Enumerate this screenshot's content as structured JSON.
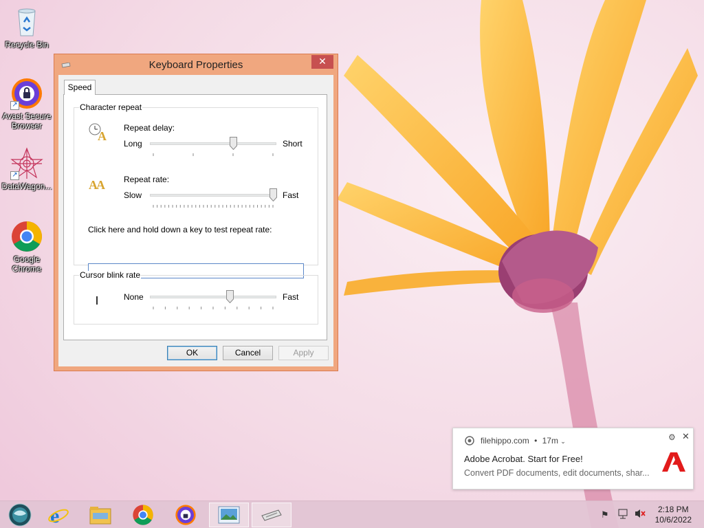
{
  "desktop": {
    "icons": [
      {
        "label": "Recycle Bin"
      },
      {
        "label": "Avast Secure\nBrowser"
      },
      {
        "label": "DataWagon..."
      },
      {
        "label": "Google\nChrome"
      }
    ]
  },
  "dialog": {
    "title": "Keyboard Properties",
    "close_glyph": "✕",
    "tabs": [
      {
        "label": "Speed"
      }
    ],
    "character_repeat": {
      "group_label": "Character repeat",
      "repeat_delay": {
        "label": "Repeat delay:",
        "min_label": "Long",
        "max_label": "Short",
        "value": 0.67,
        "ticks": 4
      },
      "repeat_rate": {
        "label": "Repeat rate:",
        "min_label": "Slow",
        "max_label": "Fast",
        "value": 1.0,
        "ticks": 32
      },
      "test_label": "Click here and hold down a key to test repeat rate:",
      "test_value": ""
    },
    "cursor_blink": {
      "group_label": "Cursor blink rate",
      "min_label": "None",
      "max_label": "Fast",
      "value": 0.64,
      "ticks": 11
    },
    "buttons": {
      "ok": "OK",
      "cancel": "Cancel",
      "apply": "Apply"
    }
  },
  "notification": {
    "source": "filehippo.com",
    "time": "17m",
    "title": "Adobe Acrobat. Start for Free!",
    "body": "Convert PDF documents, edit documents, shar..."
  },
  "taskbar": {
    "clock_time": "2:18 PM",
    "clock_date": "10/6/2022"
  },
  "colors": {
    "dialog_frame": "#f0a77f",
    "close_button": "#c75050",
    "adobe_red": "#e21b1b"
  }
}
